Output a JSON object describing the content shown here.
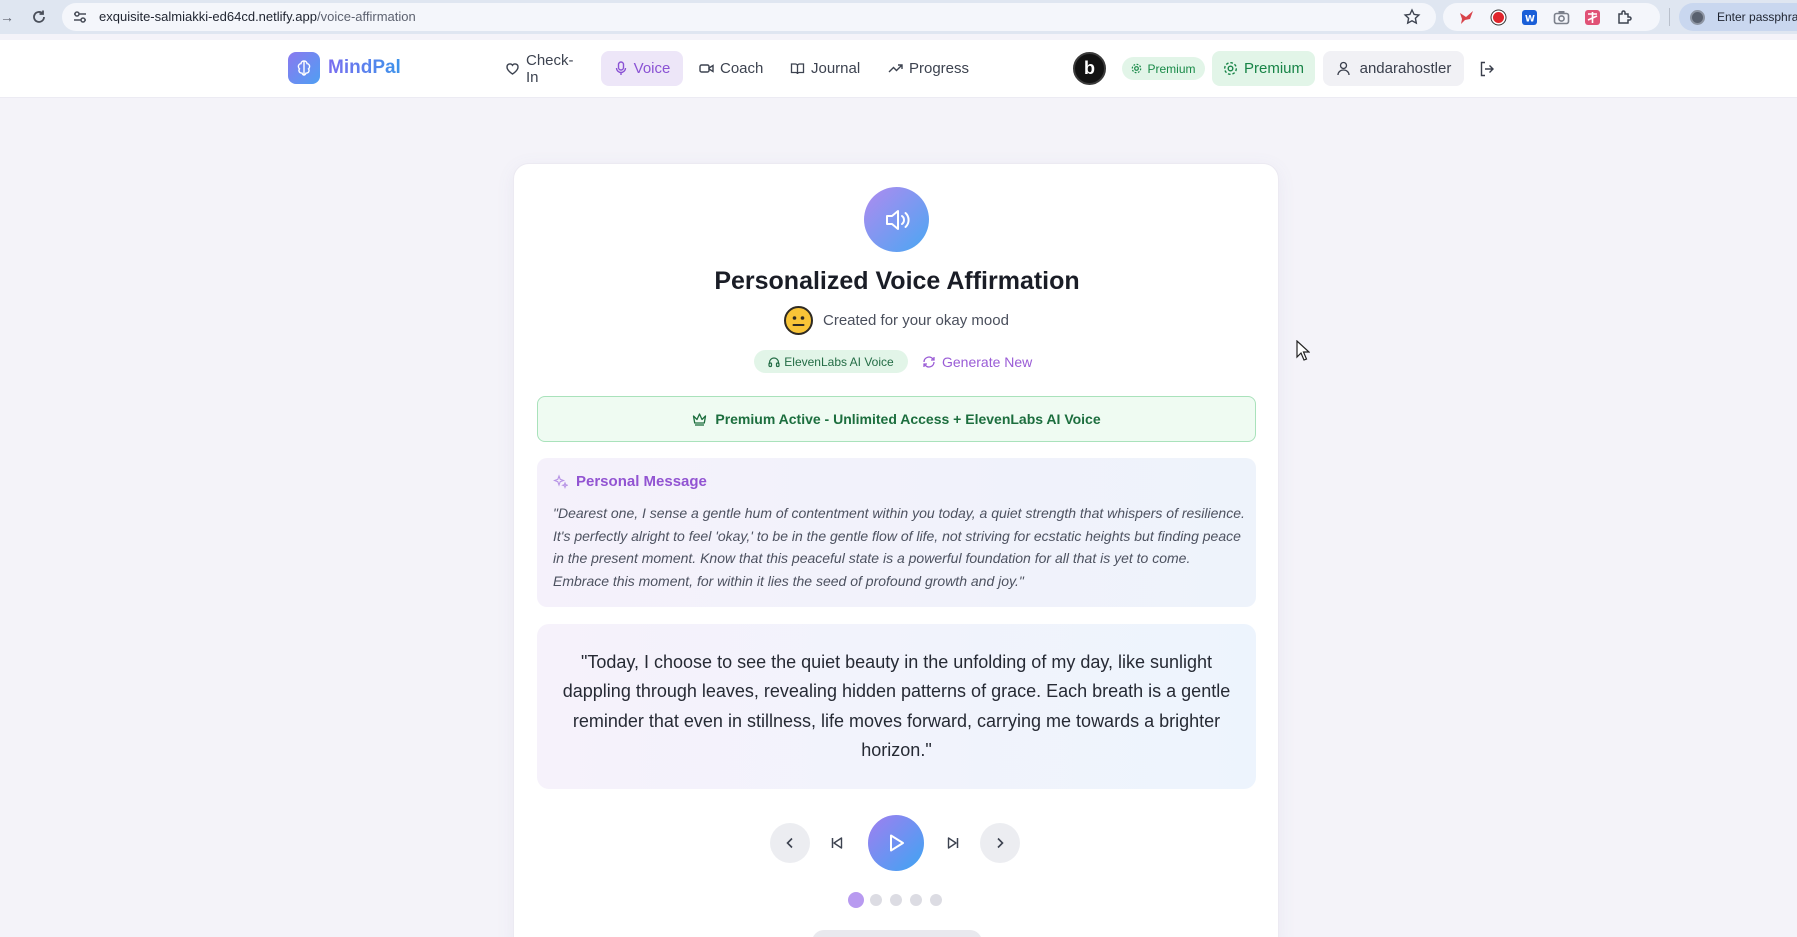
{
  "browser": {
    "url_host": "exquisite-salmiakki-ed64cd.netlify.app",
    "url_path": "/voice-affirmation",
    "profile_text": "Enter passphras",
    "extensions": [
      "bird-extension-icon",
      "record-extension-icon",
      "translate-extension-icon",
      "camera-extension-icon",
      "kanji-extension-icon",
      "puzzle-extensions-icon"
    ]
  },
  "header": {
    "logo": "MindPal",
    "nav": [
      {
        "label": "Check-In",
        "icon": "heart-icon"
      },
      {
        "label": "Voice",
        "icon": "microphone-icon",
        "active": true
      },
      {
        "label": "Coach",
        "icon": "video-icon"
      },
      {
        "label": "Journal",
        "icon": "book-icon"
      },
      {
        "label": "Progress",
        "icon": "trending-up-icon"
      }
    ],
    "b_logo": "b",
    "premium_badge": "Premium",
    "premium_button": "Premium",
    "username": "andarahostler"
  },
  "card": {
    "title": "Personalized Voice Affirmation",
    "mood_text": "Created for your okay mood",
    "voice_badge": "ElevenLabs AI Voice",
    "generate_label": "Generate New",
    "premium_banner": "Premium Active - Unlimited Access + ElevenLabs AI Voice",
    "message_title": "Personal Message",
    "message_text": "\"Dearest one, I sense a gentle hum of contentment within you today, a quiet strength that whispers of resilience. It's perfectly alright to feel 'okay,' to be in the gentle flow of life, not striving for ecstatic heights but finding peace in the present moment. Know that this peaceful state is a powerful foundation for all that is yet to come. Embrace this moment, for within it lies the seed of profound growth and joy.\"",
    "affirmation_text": "\"Today, I choose to see the quiet beauty in the unfolding of my day, like sunlight dappling through leaves, revealing hidden patterns of grace. Each breath is a gentle reminder that even in stillness, life moves forward, carrying me towards a brighter horizon.\"",
    "current_affirmation": 1,
    "total_affirmations": 5
  },
  "colors": {
    "accent_purple": "#8a52d4",
    "premium_green": "#188447",
    "gradient_start": "#a07ef0",
    "gradient_end": "#3ea5f3"
  }
}
